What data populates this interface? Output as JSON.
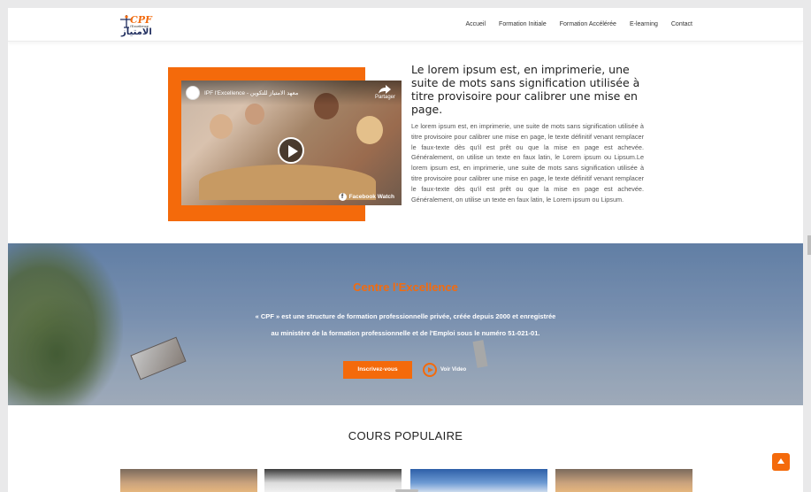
{
  "header": {
    "logo_text": "CPF",
    "logo_sub": "l'Excellence",
    "logo_arabic": "الامتياز",
    "nav": [
      "Accueil",
      "Formation Initiale",
      "Formation Accélérée",
      "E-learning",
      "Contact"
    ]
  },
  "video": {
    "channel_name": "IPF l'Excellence - معهد الامتياز للتكوين",
    "share_label": "Partager",
    "watermark": "Facebook Watch",
    "play_icon": "play-icon"
  },
  "intro": {
    "title": "Le lorem ipsum est, en imprimerie, une suite de mots sans signification utilisée à titre provisoire pour calibrer une mise en page.",
    "body": "Le lorem ipsum est, en imprimerie, une suite de mots sans signification utilisée à titre provisoire pour calibrer une mise en page, le texte définitif venant remplacer le faux-texte dès qu'il est prêt ou que la mise en page est achevée. Généralement, on utilise un texte en faux latin, le Lorem ipsum ou Lipsum.Le lorem ipsum est, en imprimerie, une suite de mots sans signification utilisée à titre provisoire pour calibrer une mise en page, le texte définitif venant remplacer le faux-texte dès qu'il est prêt ou que la mise en page est achevée. Généralement, on utilise un texte en faux latin, le Lorem ipsum ou Lipsum."
  },
  "hero": {
    "title": "Centre l'Excellence",
    "line1": "« CPF » est une structure de formation professionnelle privée, créée depuis 2000 et enregistrée",
    "line2": "au ministère de la formation professionnelle et de l'Emploi sous le numéro 51-021-01.",
    "cta_label": "Inscrivez-vous",
    "video_label": "Voir Video"
  },
  "cours": {
    "title": "COURS POPULAIRE"
  },
  "colors": {
    "accent": "#f46a0b",
    "hero_title": "#f26b0f"
  }
}
